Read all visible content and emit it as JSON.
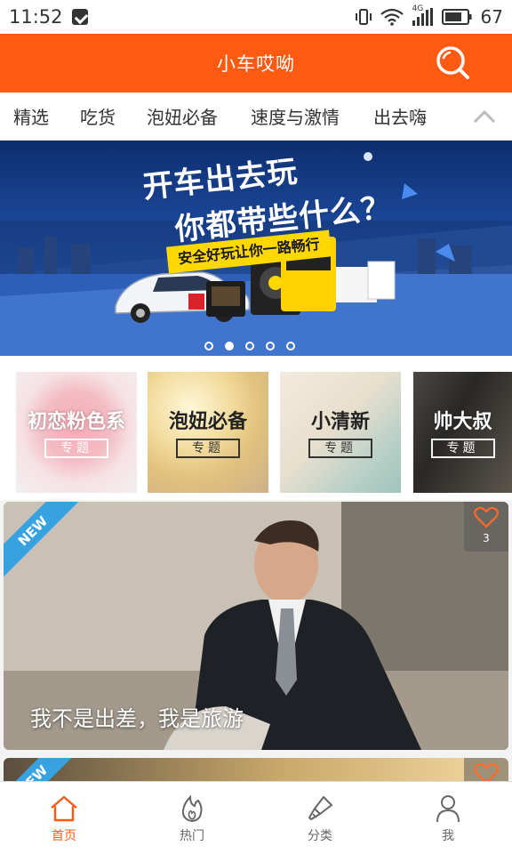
{
  "status_bar": {
    "time": "11:52",
    "network": "4G",
    "battery": "67",
    "icons": [
      "notification-icon",
      "vibrate-icon",
      "wifi-icon",
      "signal-icon",
      "battery-icon"
    ]
  },
  "header": {
    "title": "小车哎呦",
    "search_icon": "search-icon",
    "accent_color": "#ff5a12"
  },
  "category_tabs": [
    {
      "label": "精选"
    },
    {
      "label": "吃货"
    },
    {
      "label": "泡妞必备"
    },
    {
      "label": "速度与激情"
    },
    {
      "label": "出去嗨"
    }
  ],
  "banner": {
    "title_line1": "开车出去玩",
    "title_line2": "你都带些什么？",
    "tagline": "安全好玩让你一路畅行",
    "slide_count": 5,
    "active_slide": 2
  },
  "topics": [
    {
      "title": "初恋粉色系",
      "tag": "专题"
    },
    {
      "title": "泡妞必备",
      "tag": "专题"
    },
    {
      "title": "小清新",
      "tag": "专题"
    },
    {
      "title": "帅大叔",
      "tag": "专题"
    }
  ],
  "feed": [
    {
      "badge": "NEW",
      "likes": "3",
      "caption": "我不是出差，我是旅游"
    },
    {
      "badge": "NEW",
      "likes": "",
      "caption": ""
    }
  ],
  "bottom_nav": [
    {
      "label": "首页",
      "icon": "home-icon",
      "active": true
    },
    {
      "label": "热门",
      "icon": "flame-icon",
      "active": false
    },
    {
      "label": "分类",
      "icon": "brush-icon",
      "active": false
    },
    {
      "label": "我",
      "icon": "user-icon",
      "active": false
    }
  ]
}
